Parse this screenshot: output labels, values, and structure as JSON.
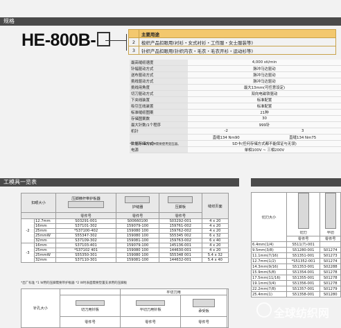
{
  "header_bar": {
    "title": "规格"
  },
  "model": {
    "name": "HE-800B-"
  },
  "usage": {
    "heading": "主要用途",
    "items": [
      {
        "num": "2",
        "text": "梭织产品扣眼用(衬衫・女式衬衫・工作服・女士服装等)"
      },
      {
        "num": "3",
        "text": "针织产品扣眼用(针织内衣・毛衣・毛衣开衫・运动衫等)"
      }
    ]
  },
  "spec": {
    "rows": [
      {
        "k": "最高缝纫速度",
        "v": "4,000 sti/min"
      },
      {
        "k": "针幅驱动方式",
        "v": "脉冲马达驱动"
      },
      {
        "k": "送布驱动方式",
        "v": "脉冲马达驱动"
      },
      {
        "k": "挑线驱动方式",
        "v": "脉冲马达驱动"
      },
      {
        "k": "挑线用角度",
        "v": "最大13mm(可任意设定)"
      },
      {
        "k": "切刀驱动方式",
        "v": "双向电磁铁驱动"
      },
      {
        "k": "下夹线装置",
        "v": "标准配置"
      },
      {
        "k": "吸引压线装置",
        "v": "标准配置"
      },
      {
        "k": "标准缝纫图案",
        "v": "21种"
      },
      {
        "k": "存储图案数",
        "v": "30"
      },
      {
        "k": "最大针数/1个程序",
        "v": "999针"
      },
      {
        "k": "机针",
        "v2": "-2",
        "v3": "3"
      },
      {
        "k": "",
        "v2": "直缝134 Nm90",
        "v3": "直缝134 Nm75"
      },
      {
        "k": "数据存储方式",
        "v": "SD卡(任何存储方式都不能保证与无误)"
      },
      {
        "k": "电源",
        "v": "单相100V ~ 三相200V"
      }
    ],
    "note": "*1: 装有100V机种需要使用变压器。"
  },
  "tools": {
    "section_title": "工模具一览表",
    "headers": {
      "size": "扣眼大小",
      "presser": "压脚横杆带护板器",
      "guard": "护缝器",
      "plate": "压脚板",
      "plate2": "缝纫页面",
      "part_no": "零件号"
    },
    "rows": [
      {
        "grp": "-2",
        "size": "12.7mm",
        "a": "S03291-001",
        "b": "S00660100",
        "c": "S03292-001",
        "d": "4 x 20"
      },
      {
        "grp": "",
        "size": "16mm",
        "a": "S37101-302",
        "b": "159079-100",
        "c": "159761-002",
        "d": "4 x 20"
      },
      {
        "grp": "",
        "size": "25mm",
        "a": "*S37100-402",
        "b": "159080 100",
        "c": "159762-002",
        "d": "4 x 20"
      },
      {
        "grp": "",
        "size": "25mmW",
        "a": "S55347-302",
        "b": "159080 100",
        "c": "S55345 002",
        "d": "6 x 32"
      },
      {
        "grp": "",
        "size": "32mm",
        "a": "S37109-302",
        "b": "159081-100",
        "c": "159763-002",
        "d": "6 x 40"
      },
      {
        "grp": "-3",
        "size": "16mm",
        "a": "S37103-401",
        "b": "159079-100",
        "c": "145136-001",
        "d": "4 x 20"
      },
      {
        "grp": "",
        "size": "25mm",
        "a": "*S37102 401",
        "b": "159080 100",
        "c": "144630-001",
        "d": "4 x 20"
      },
      {
        "grp": "",
        "size": "25mmW",
        "a": "S55350-301",
        "b": "159080 100",
        "c": "S55348 001",
        "d": "5.4 x 32"
      },
      {
        "grp": "",
        "size": "32mm",
        "a": "S37110-301",
        "b": "159081-100",
        "c": "144632-001",
        "d": "5.4 x 40"
      }
    ],
    "note": "*出厂标准  *1 W用的压脚需要带护板器   *2 W时表面需要垫置支承用的压脚板"
  },
  "needle": {
    "label": "针孔大小",
    "group": "平切刀用",
    "items": [
      "切刀用针板",
      "平切刀用针板",
      "承受板"
    ],
    "part_no": "零件号"
  },
  "knife": {
    "label": "切刀大小",
    "items": [
      "切刀",
      "平切"
    ],
    "part_no": "零件号",
    "rows": [
      {
        "k": "6.4mm(1/4)",
        "a": "S511(7)-001",
        "b": ""
      },
      {
        "k": "9.5mm(3/8)",
        "a": "S51280-001",
        "b": "S01274"
      },
      {
        "k": "11.1mm(7/16)",
        "a": "S51351-001",
        "b": "S01273"
      },
      {
        "k": "12.7mm(1/2)",
        "a": "*S51352-001",
        "b": "S01274"
      },
      {
        "k": "14.3mm(9/16)",
        "a": "S51353-001",
        "b": "S02288"
      },
      {
        "k": "15.9mm(5/8)",
        "a": "S51354-001",
        "b": "S01278"
      },
      {
        "k": "17.5mm(11/16)",
        "a": "S51355-001",
        "b": "S01278"
      },
      {
        "k": "19.1mm(3/4)",
        "a": "S51356-001",
        "b": "S01278"
      },
      {
        "k": "22.2mm(7/8)",
        "a": "S51357-001",
        "b": "S01279"
      },
      {
        "k": "25.4mm(1)",
        "a": "S51358-001",
        "b": "S01280"
      }
    ]
  },
  "watermark": {
    "text": "全球纺织网"
  },
  "colors": {
    "bar": "#4a4a4a",
    "usage_head": "#f3c86e",
    "usage_border": "#c8a24a"
  }
}
